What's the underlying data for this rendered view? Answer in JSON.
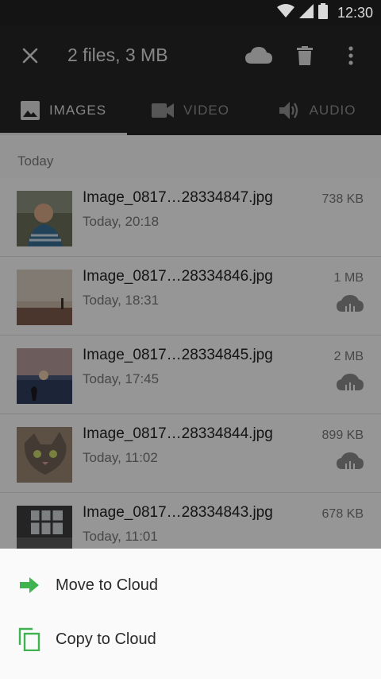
{
  "status_bar": {
    "time": "12:30"
  },
  "toolbar": {
    "title": "2 files, 3 MB",
    "icons": [
      "close-icon",
      "cloud-icon",
      "trash-icon",
      "more-vert-icon"
    ]
  },
  "tabs": [
    {
      "label": "IMAGES",
      "icon": "image-icon",
      "active": true
    },
    {
      "label": "VIDEO",
      "icon": "videocam-icon",
      "active": false
    },
    {
      "label": "AUDIO",
      "icon": "volume-icon",
      "active": false
    }
  ],
  "list": {
    "section": "Today",
    "items": [
      {
        "name": "Image_0817…28334847.jpg",
        "time": "Today, 20:18",
        "size": "738 KB",
        "cloud": false
      },
      {
        "name": "Image_0817…28334846.jpg",
        "time": "Today, 18:31",
        "size": "1 MB",
        "cloud": true
      },
      {
        "name": "Image_0817…28334845.jpg",
        "time": "Today, 17:45",
        "size": "2 MB",
        "cloud": true
      },
      {
        "name": "Image_0817…28334844.jpg",
        "time": "Today, 11:02",
        "size": "899 KB",
        "cloud": true
      },
      {
        "name": "Image_0817…28334843.jpg",
        "time": "Today, 11:01",
        "size": "678 KB",
        "cloud": false
      }
    ]
  },
  "sheet": {
    "move_label": "Move to Cloud",
    "copy_label": "Copy to Cloud"
  },
  "colors": {
    "accent_green": "#3fb34f",
    "toolbar": "#262626"
  }
}
